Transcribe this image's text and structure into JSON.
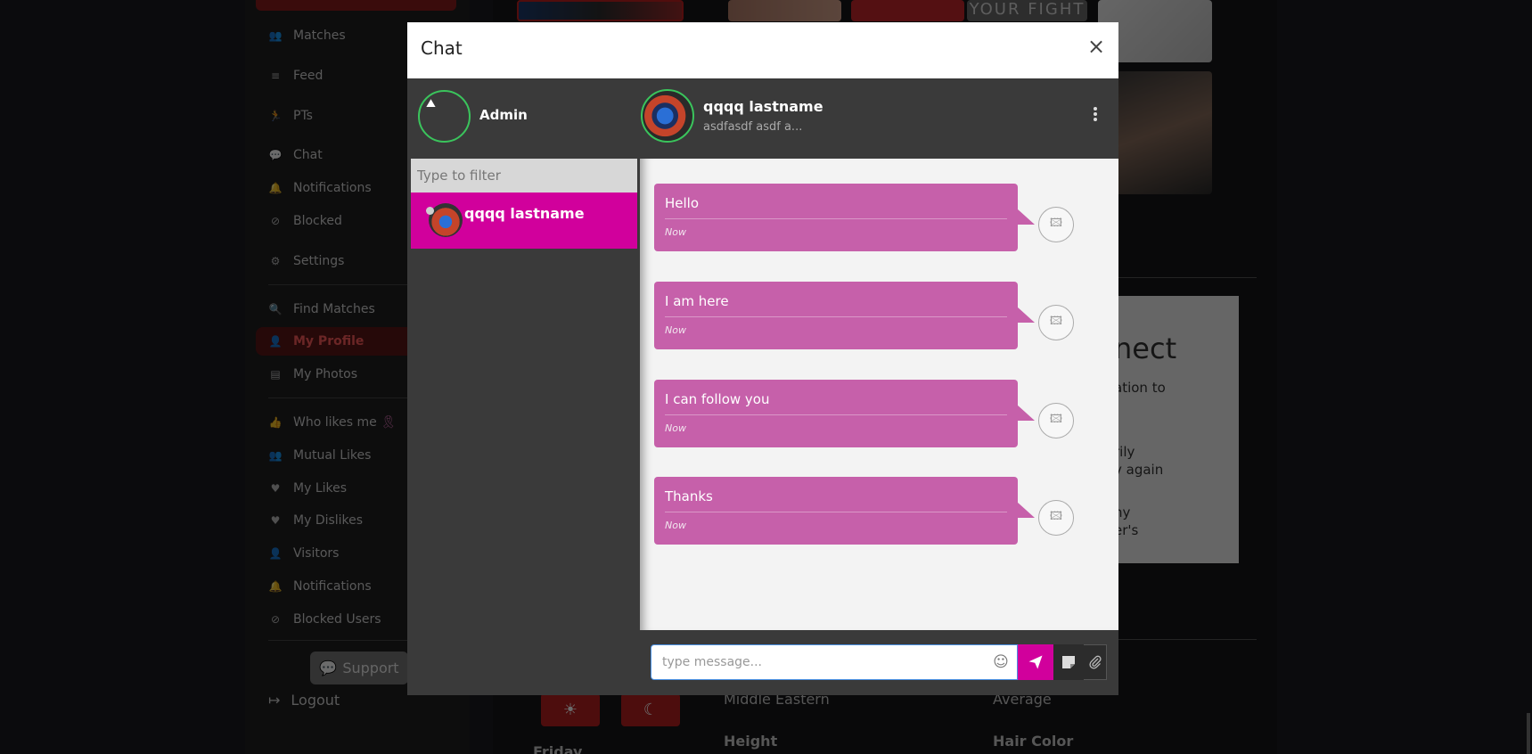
{
  "sidebar": {
    "items": [
      {
        "label": "Matches",
        "icon": "users-icon"
      },
      {
        "label": "Feed",
        "icon": "layers-icon"
      },
      {
        "label": "PTs",
        "icon": "running-icon"
      },
      {
        "label": "Chat",
        "icon": "chat-icon"
      },
      {
        "label": "Notifications",
        "icon": "bell-icon"
      },
      {
        "label": "Blocked",
        "icon": "ban-icon"
      },
      {
        "label": "Settings",
        "icon": "gear-icon"
      },
      {
        "label": "Find Matches",
        "icon": "search-icon"
      },
      {
        "label": "My Profile",
        "icon": "user-icon"
      },
      {
        "label": "My Photos",
        "icon": "photos-icon"
      },
      {
        "label": "Who likes me",
        "icon": "thumbs-up-icon"
      },
      {
        "label": "Mutual Likes",
        "icon": "users-icon"
      },
      {
        "label": "My Likes",
        "icon": "heart-icon"
      },
      {
        "label": "My Dislikes",
        "icon": "broken-heart-icon"
      },
      {
        "label": "Visitors",
        "icon": "user-icon"
      },
      {
        "label": "Notifications",
        "icon": "bell-icon"
      },
      {
        "label": "Blocked Users",
        "icon": "ban-icon"
      }
    ],
    "support_label": "Support",
    "logout_label": "Logout"
  },
  "background": {
    "photo_text": "YOUR FIGHT",
    "card_heading": "nect",
    "card_lines": [
      "ation to",
      "rily",
      "y again",
      "ny",
      "er's"
    ],
    "labels": {
      "ethnicity": "Middle Eastern",
      "body": "Average",
      "height": "Height",
      "hair_color": "Hair Color",
      "day": "Friday"
    }
  },
  "modal": {
    "title": "Chat",
    "close_label": "×",
    "me": {
      "name": "Admin"
    },
    "peer": {
      "name": "qqqq lastname",
      "status": "asdfasdf asdf a..."
    },
    "filter": {
      "placeholder": "Type to filter"
    },
    "contacts": [
      {
        "name": "qqqq lastname"
      }
    ],
    "messages": [
      {
        "text": "Hello",
        "time": "Now"
      },
      {
        "text": "I am here",
        "time": "Now"
      },
      {
        "text": "I can follow you",
        "time": "Now"
      },
      {
        "text": "Thanks",
        "time": "Now"
      }
    ],
    "composer": {
      "placeholder": "type message..."
    }
  },
  "colors": {
    "accent": "#d1009c",
    "bubble": "#c660aa",
    "online_ring": "#3ac45c",
    "brand_red": "#b81e1e"
  }
}
